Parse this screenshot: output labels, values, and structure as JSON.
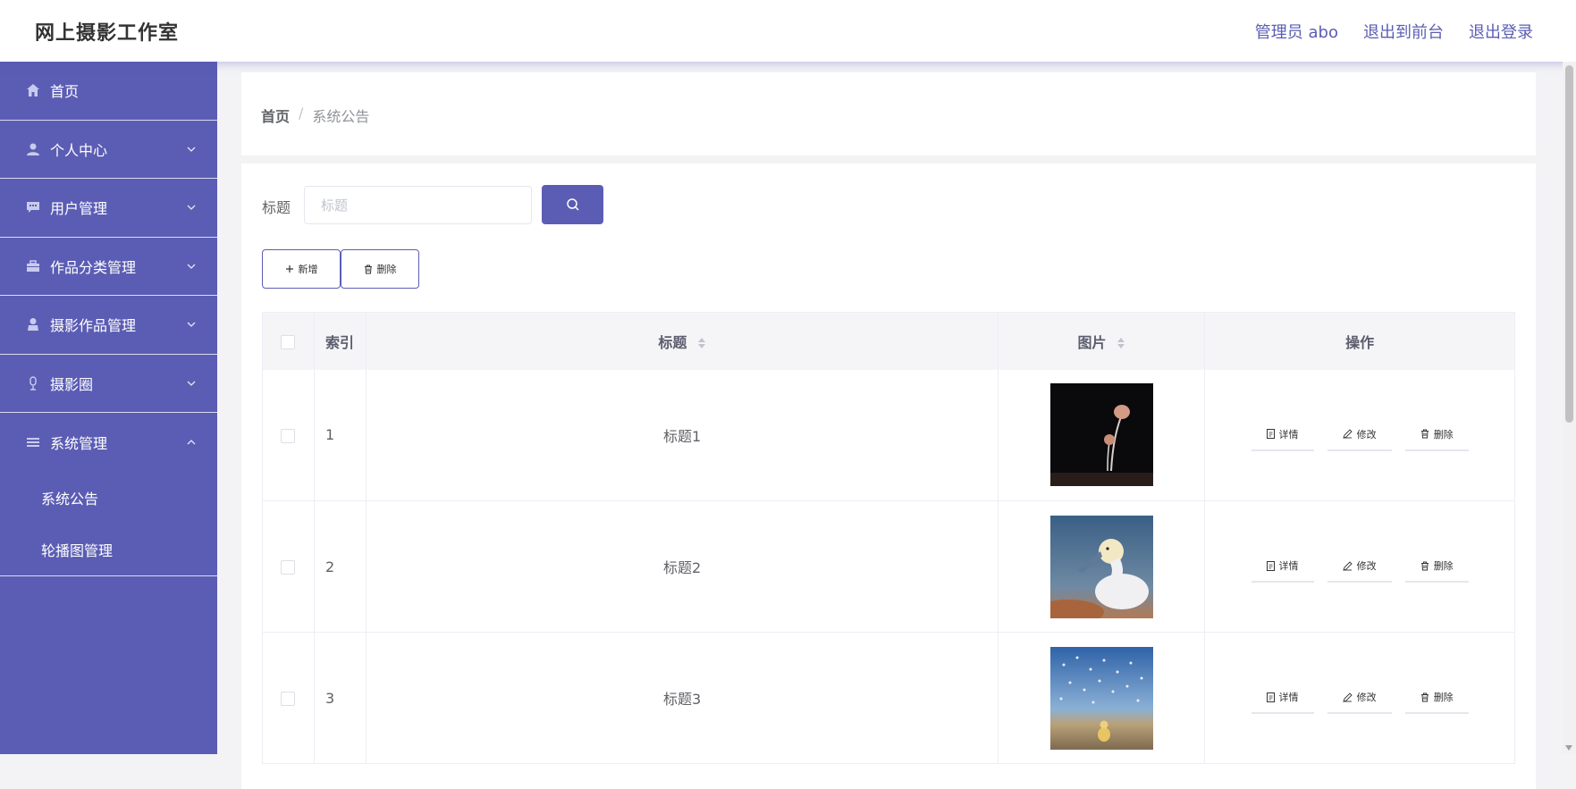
{
  "header": {
    "brand": "网上摄影工作室",
    "admin_label": "管理员 abo",
    "front_label": "退出到前台",
    "logout_label": "退出登录"
  },
  "sidebar": {
    "items": [
      {
        "label": "首页",
        "icon": "home-icon"
      },
      {
        "label": "个人中心",
        "icon": "user-icon"
      },
      {
        "label": "用户管理",
        "icon": "chat-icon"
      },
      {
        "label": "作品分类管理",
        "icon": "briefcase-icon"
      },
      {
        "label": "摄影作品管理",
        "icon": "person-icon"
      },
      {
        "label": "摄影圈",
        "icon": "microphone-icon"
      },
      {
        "label": "系统管理",
        "icon": "list-icon"
      }
    ],
    "sub_items": [
      {
        "label": "系统公告"
      },
      {
        "label": "轮播图管理"
      }
    ]
  },
  "breadcrumb": {
    "home": "首页",
    "separator": "/",
    "current": "系统公告"
  },
  "search": {
    "label": "标题",
    "placeholder": "标题",
    "value": ""
  },
  "actions": {
    "add_label": "新增",
    "delete_label": "删除"
  },
  "table": {
    "columns": {
      "index": "索引",
      "title": "标题",
      "image": "图片",
      "ops": "操作"
    },
    "rows": [
      {
        "index": "1",
        "title": "标题1",
        "image": "mushroom photo"
      },
      {
        "index": "2",
        "title": "标题2",
        "image": "gannet bird photo"
      },
      {
        "index": "3",
        "title": "标题3",
        "image": "bird flock photo"
      }
    ],
    "op_labels": {
      "detail": "详情",
      "edit": "修改",
      "delete": "删除"
    }
  },
  "colors": {
    "accent": "#5b5db4",
    "sidebar_bg": "#5b5db4"
  }
}
